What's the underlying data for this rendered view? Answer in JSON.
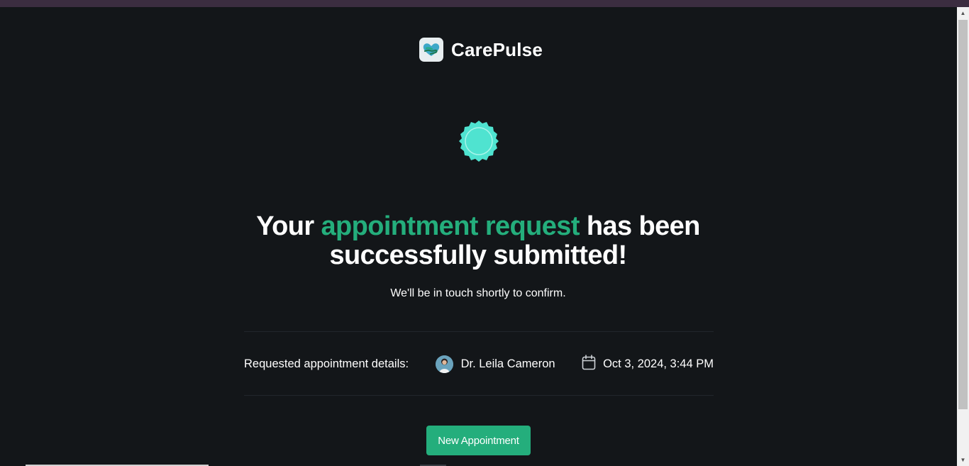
{
  "brand": {
    "name": "CarePulse",
    "logo_icon": "heart-hand-icon"
  },
  "success": {
    "badge_icon": "success-badge-icon",
    "badge_color": "#4fe3d0",
    "headline_part1": "Your ",
    "headline_highlight": "appointment request",
    "headline_part2": " has been successfully submitted!",
    "highlight_color": "#24ae7c",
    "subtext": "We'll be in touch shortly to confirm."
  },
  "details": {
    "label": "Requested appointment details:",
    "doctor_name": "Dr. Leila Cameron",
    "date_icon": "calendar-icon",
    "datetime": "Oct 3, 2024, 3:44 PM"
  },
  "actions": {
    "new_appointment_label": "New Appointment",
    "accent": "#24ae7c"
  },
  "theme": {
    "background": "#131619",
    "top_strip": "#3b2d40"
  }
}
